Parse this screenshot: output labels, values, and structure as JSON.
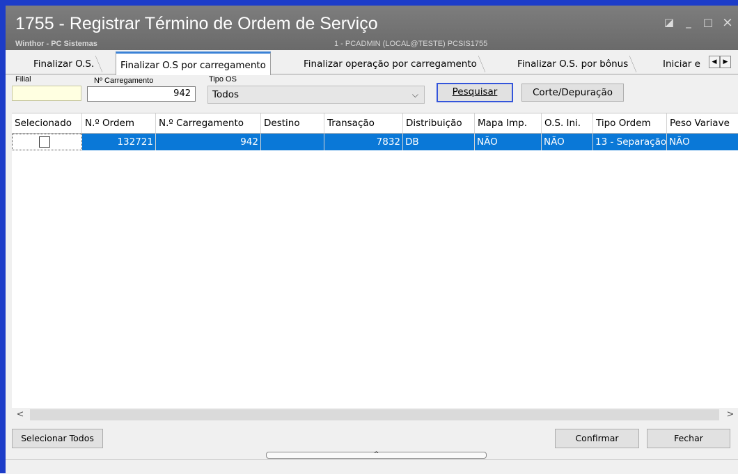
{
  "window": {
    "title": "1755 - Registrar Término de Ordem de Serviço",
    "subtitle": "Winthor - PC Sistemas",
    "user_info": "1 - PCADMIN (LOCAL@TESTE)   PCSIS1755",
    "controls": {
      "restore": "◪",
      "minimize": "_",
      "maximize": "□",
      "close": "×"
    }
  },
  "tabs": [
    {
      "label": "Finalizar O.S."
    },
    {
      "label": "Finalizar O.S por carregamento"
    },
    {
      "label": "Finalizar operação por carregamento"
    },
    {
      "label": "Finalizar O.S. por bônus"
    },
    {
      "label": "Iniciar e"
    }
  ],
  "tab_scroll": {
    "left": "◀",
    "right": "▶"
  },
  "filters": {
    "filial_label": "Filial",
    "filial_value": "",
    "carregamento_label": "Nº Carregamento",
    "carregamento_value": "942",
    "tipo_os_label": "Tipo OS",
    "tipo_os_value": "Todos",
    "tipo_os_arrow": "⌵"
  },
  "buttons": {
    "pesquisar": "Pesquisar",
    "corte": "Corte/Depuração",
    "selecionar_todos": "Selecionar Todos",
    "confirmar": "Confirmar",
    "fechar": "Fechar"
  },
  "grid": {
    "columns": [
      "Selecionado",
      "N.º Ordem",
      "N.º Carregamento",
      "Destino",
      "Transação",
      "Distribuição",
      "Mapa Imp.",
      "O.S. Ini.",
      "Tipo Ordem",
      "Peso Variave"
    ],
    "rows": [
      {
        "selecionado": "",
        "ordem": "132721",
        "carregamento": "942",
        "destino": "",
        "transacao": "7832",
        "distribuicao": "DB",
        "mapa": "NÃO",
        "os_ini": "NÃO",
        "tipo_ordem": "13 - Separação",
        "peso": "NÃO"
      }
    ]
  },
  "scroll": {
    "left": "<",
    "right": ">"
  },
  "splitter_glyph": "^",
  "colors": {
    "selection": "#0a78d7",
    "frame": "#1c3cc8",
    "titlebar": "#737373",
    "focus": "#3455db"
  }
}
